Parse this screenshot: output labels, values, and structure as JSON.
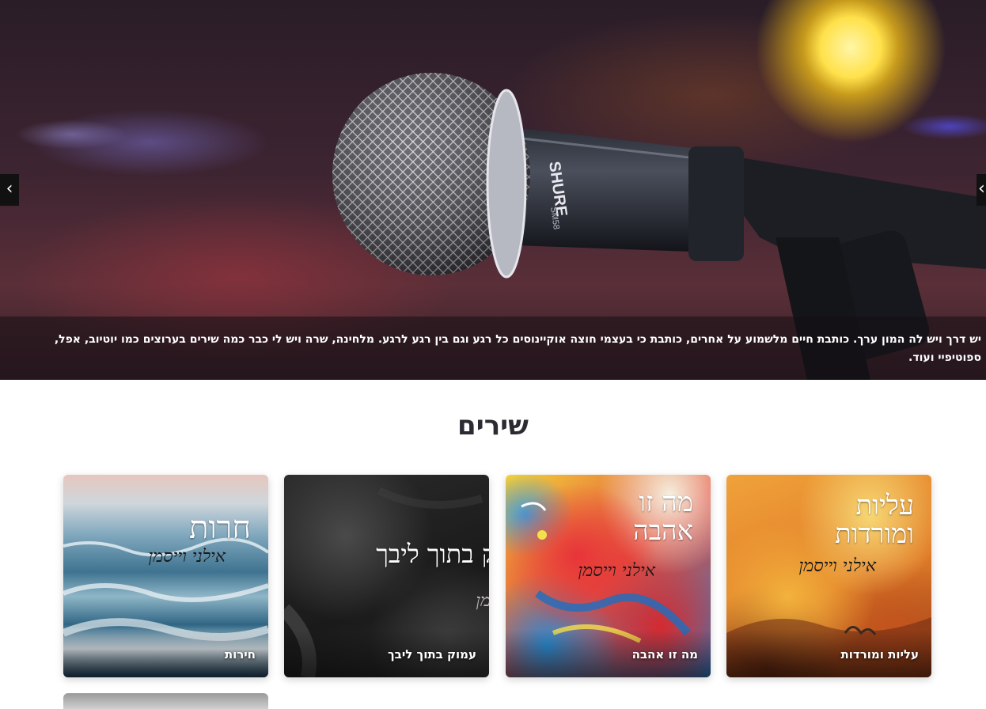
{
  "hero": {
    "caption": "יש דרך ויש לה המון ערך. כותבת חיים מלשמוע על אחרים, כותבת כי בעצמי חוצה אוקיינוסים כל רגע וגם בין רגע לרגע. מלחינה, שרה ויש לי כבר כמה שירים בערוצים כמו יוטיוב, אפל, ספוטיפיי ועוד.",
    "mic_brand": "SHURE",
    "mic_model": "SM58",
    "prev_arrow": "‹",
    "next_arrow": "‹"
  },
  "songs": {
    "title": "שירים",
    "cards": [
      {
        "label": "עליות ומורדות",
        "cover_title_line1": "עליות",
        "cover_title_line2": "ומורדות",
        "cover_artist": "אילני וייסמן"
      },
      {
        "label": "מה זו אהבה",
        "cover_title_line1": "מה זו",
        "cover_title_line2": "אהבה",
        "cover_artist": "אילני וייסמן"
      },
      {
        "label": "עמוק בתוך ליבך",
        "cover_title_line1": "ק בתוך ליבך",
        "cover_artist": "מן"
      },
      {
        "label": "חירות",
        "cover_title_line1": "חרות",
        "cover_artist": "אילני וייסמן"
      }
    ]
  }
}
